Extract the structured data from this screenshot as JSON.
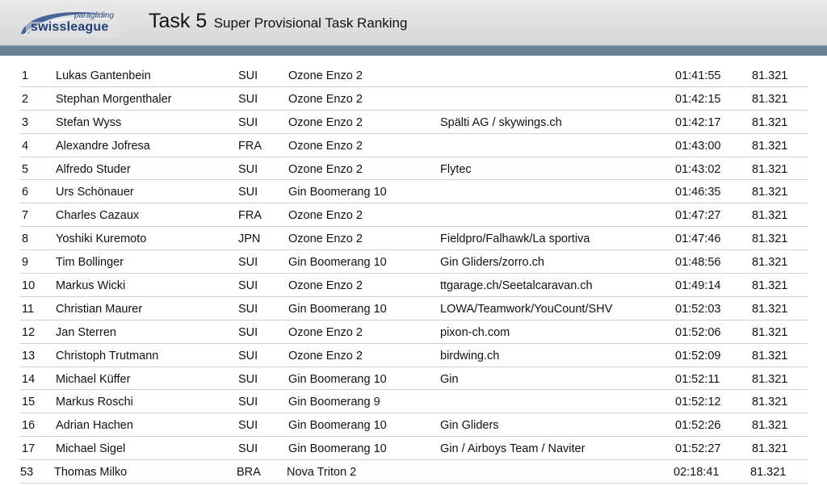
{
  "header": {
    "logo_sub": "paragliding",
    "logo_main": "swissleague",
    "task_label": "Task 5",
    "subtitle": "Super Provisional Task Ranking"
  },
  "rows": [
    {
      "rank": "1",
      "name": "Lukas Gantenbein",
      "nat": "SUI",
      "glider": "Ozone Enzo 2",
      "sponsor": "",
      "time": "01:41:55",
      "score": "81.321"
    },
    {
      "rank": "2",
      "name": "Stephan Morgenthaler",
      "nat": "SUI",
      "glider": "Ozone Enzo 2",
      "sponsor": "",
      "time": "01:42:15",
      "score": "81.321"
    },
    {
      "rank": "3",
      "name": "Stefan Wyss",
      "nat": "SUI",
      "glider": "Ozone Enzo 2",
      "sponsor": "Spälti AG / skywings.ch",
      "time": "01:42:17",
      "score": "81.321"
    },
    {
      "rank": "4",
      "name": "Alexandre Jofresa",
      "nat": "FRA",
      "glider": "Ozone Enzo 2",
      "sponsor": "",
      "time": "01:43:00",
      "score": "81.321"
    },
    {
      "rank": "5",
      "name": "Alfredo Studer",
      "nat": "SUI",
      "glider": "Ozone Enzo 2",
      "sponsor": "Flytec",
      "time": "01:43:02",
      "score": "81.321"
    },
    {
      "rank": "6",
      "name": "Urs Schönauer",
      "nat": "SUI",
      "glider": "Gin Boomerang 10",
      "sponsor": "",
      "time": "01:46:35",
      "score": "81.321"
    },
    {
      "rank": "7",
      "name": "Charles Cazaux",
      "nat": "FRA",
      "glider": "Ozone Enzo 2",
      "sponsor": "",
      "time": "01:47:27",
      "score": "81.321"
    },
    {
      "rank": "8",
      "name": "Yoshiki Kuremoto",
      "nat": "JPN",
      "glider": "Ozone Enzo 2",
      "sponsor": "Fieldpro/Falhawk/La sportiva",
      "time": "01:47:46",
      "score": "81.321"
    },
    {
      "rank": "9",
      "name": "Tim Bollinger",
      "nat": "SUI",
      "glider": "Gin Boomerang 10",
      "sponsor": "Gin Gliders/zorro.ch",
      "time": "01:48:56",
      "score": "81.321"
    },
    {
      "rank": "10",
      "name": "Markus Wicki",
      "nat": "SUI",
      "glider": "Ozone Enzo 2",
      "sponsor": "ttgarage.ch/Seetalcaravan.ch",
      "time": "01:49:14",
      "score": "81.321"
    },
    {
      "rank": "11",
      "name": "Christian Maurer",
      "nat": "SUI",
      "glider": "Gin Boomerang 10",
      "sponsor": "LOWA/Teamwork/YouCount/SHV",
      "time": "01:52:03",
      "score": "81.321"
    },
    {
      "rank": "12",
      "name": "Jan Sterren",
      "nat": "SUI",
      "glider": "Ozone Enzo 2",
      "sponsor": "pixon-ch.com",
      "time": "01:52:06",
      "score": "81.321"
    },
    {
      "rank": "13",
      "name": "Christoph Trutmann",
      "nat": "SUI",
      "glider": "Ozone Enzo 2",
      "sponsor": "birdwing.ch",
      "time": "01:52:09",
      "score": "81.321"
    },
    {
      "rank": "14",
      "name": "Michael Küffer",
      "nat": "SUI",
      "glider": "Gin Boomerang 10",
      "sponsor": "Gin",
      "time": "01:52:11",
      "score": "81.321"
    },
    {
      "rank": "15",
      "name": "Markus Roschi",
      "nat": "SUI",
      "glider": "Gin Boomerang 9",
      "sponsor": "",
      "time": "01:52:12",
      "score": "81.321"
    },
    {
      "rank": "16",
      "name": "Adrian Hachen",
      "nat": "SUI",
      "glider": "Gin Boomerang 10",
      "sponsor": "Gin Gliders",
      "time": "01:52:26",
      "score": "81.321"
    },
    {
      "rank": "17",
      "name": "Michael Sigel",
      "nat": "SUI",
      "glider": "Gin Boomerang 10",
      "sponsor": "Gin / Airboys Team / Naviter",
      "time": "01:52:27",
      "score": "81.321"
    },
    {
      "rank": "53",
      "name": "Thomas Milko",
      "nat": "BRA",
      "glider": "Nova Triton 2",
      "sponsor": "",
      "time": "02:18:41",
      "score": "81.321"
    }
  ],
  "colors": {
    "header_bg": "#dcdcdc",
    "header_bar": "#6a8294",
    "logo_blue": "#213e78",
    "row_divider": "#cfcfcf"
  }
}
